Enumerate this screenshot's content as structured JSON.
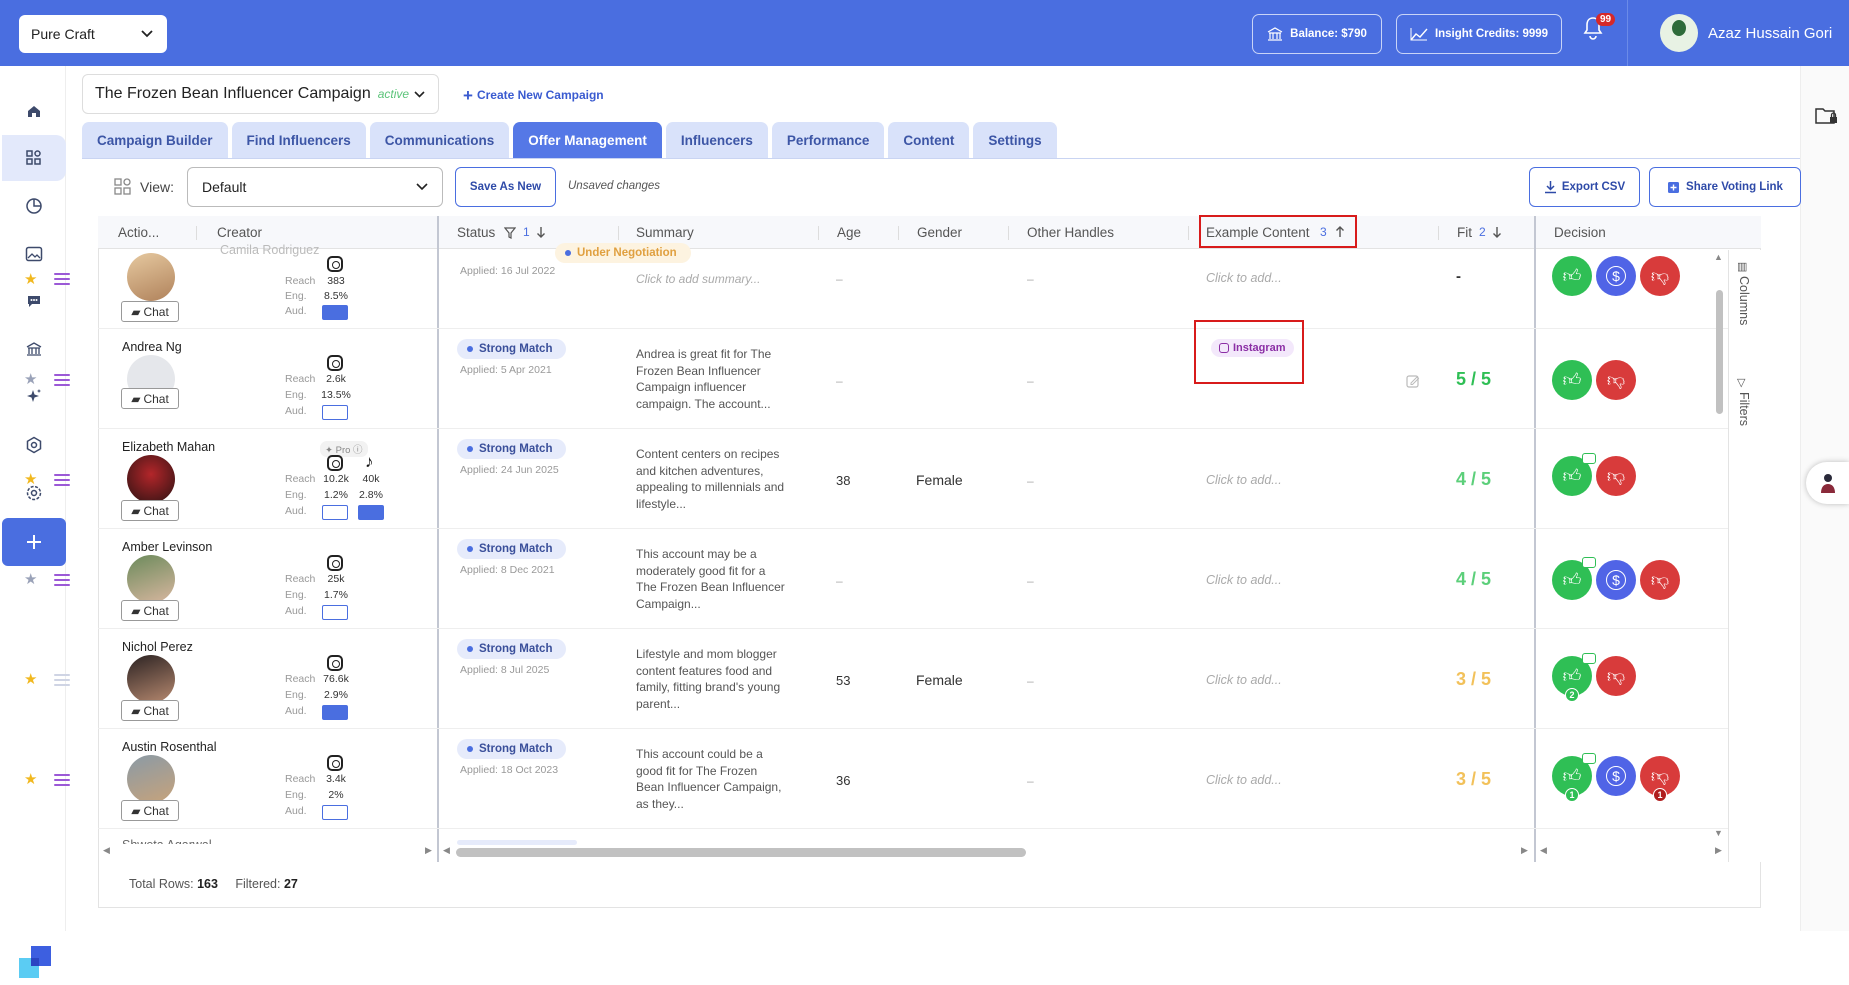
{
  "workspace": {
    "name": "Pure Craft"
  },
  "topbar": {
    "balance": "Balance: $790",
    "credits": "Insight Credits: 9999",
    "notifications": "99",
    "user_name": "Azaz Hussain Gori"
  },
  "campaign": {
    "name": "The Frozen Bean Influencer Campaign",
    "status": "active",
    "create_label": "Create New Campaign"
  },
  "tabs": [
    "Campaign Builder",
    "Find Influencers",
    "Communications",
    "Offer Management",
    "Influencers",
    "Performance",
    "Content",
    "Settings"
  ],
  "active_tab": "Offer Management",
  "toolbar": {
    "view_label": "View:",
    "view_value": "Default",
    "save_as_new": "Save As New",
    "unsaved": "Unsaved changes",
    "export_csv": "Export CSV",
    "share_voting": "Share Voting Link"
  },
  "columns": {
    "actions": "Actio...",
    "creator": "Creator",
    "status": "Status",
    "status_filter_count": "1",
    "summary": "Summary",
    "age": "Age",
    "gender": "Gender",
    "other_handles": "Other Handles",
    "example_content": "Example Content",
    "example_sort": "3",
    "fit": "Fit",
    "fit_sort": "2",
    "decision": "Decision"
  },
  "metric_labels": {
    "reach": "Reach",
    "eng": "Eng.",
    "aud": "Aud."
  },
  "chat_label": "Chat",
  "pro_label": "Pro",
  "rows": [
    {
      "name": "Camila Rodriguez",
      "starred": true,
      "reach": "383",
      "eng": "8.5%",
      "status": "Under Negotiation",
      "applied": "Applied: 16 Jul 2022",
      "summary": "Click to add summary...",
      "age": "–",
      "gender": "",
      "other": "–",
      "example": "Click to add...",
      "fit": "-"
    },
    {
      "name": "Andrea Ng",
      "starred": false,
      "reach": "2.6k",
      "eng": "13.5%",
      "status": "Strong Match",
      "applied": "Applied: 5 Apr 2021",
      "summary": "Andrea is great fit for The Frozen Bean Influencer Campaign influencer campaign. The account...",
      "age": "–",
      "gender": "",
      "other": "–",
      "example": "Instagram",
      "fit": "5 / 5"
    },
    {
      "name": "Elizabeth Mahan",
      "starred": true,
      "reach": "10.2k",
      "eng": "1.2%",
      "reach2": "40k",
      "eng2": "2.8%",
      "status": "Strong Match",
      "applied": "Applied: 24 Jun 2025",
      "summary": "Content centers on recipes and kitchen adventures, appealing to millennials and lifestyle...",
      "age": "38",
      "gender": "Female",
      "other": "–",
      "example": "Click to add...",
      "fit": "4 / 5"
    },
    {
      "name": "Amber Levinson",
      "starred": false,
      "reach": "25k",
      "eng": "1.7%",
      "status": "Strong Match",
      "applied": "Applied: 8 Dec 2021",
      "summary": "This account may be a moderately good fit for a The Frozen Bean Influencer Campaign...",
      "age": "–",
      "gender": "",
      "other": "–",
      "example": "Click to add...",
      "fit": "4 / 5"
    },
    {
      "name": "Nichol Perez",
      "starred": true,
      "reach": "76.6k",
      "eng": "2.9%",
      "status": "Strong Match",
      "applied": "Applied: 8 Jul 2025",
      "summary": "Lifestyle and mom blogger content features food and family, fitting brand's young parent...",
      "age": "53",
      "gender": "Female",
      "other": "–",
      "example": "Click to add...",
      "fit": "3 / 5"
    },
    {
      "name": "Austin Rosenthal",
      "starred": true,
      "reach": "3.4k",
      "eng": "2%",
      "status": "Strong Match",
      "applied": "Applied: 18 Oct 2023",
      "summary": "This account could be a good fit for The Frozen Bean Influencer Campaign, as they...",
      "age": "36",
      "gender": "",
      "other": "–",
      "example": "Click to add...",
      "fit": "3 / 5"
    }
  ],
  "partial_next_name": "Shweta Agarwal",
  "side_panel": {
    "columns": "Columns",
    "filters": "Filters"
  },
  "footer": {
    "total_label": "Total Rows:",
    "total": "163",
    "filtered_label": "Filtered:",
    "filtered": "27"
  },
  "badges": {
    "nichol_like": "2",
    "austin_like": "1",
    "austin_dislike": "1"
  },
  "colors": {
    "brand": "#4a6ee0",
    "fit_high": "#2fbf55",
    "fit_mid": "#5ccf7a",
    "fit_low": "#f2c15a",
    "like": "#2fbf55",
    "negotiate": "#5064e6",
    "dislike": "#d83b3b"
  }
}
